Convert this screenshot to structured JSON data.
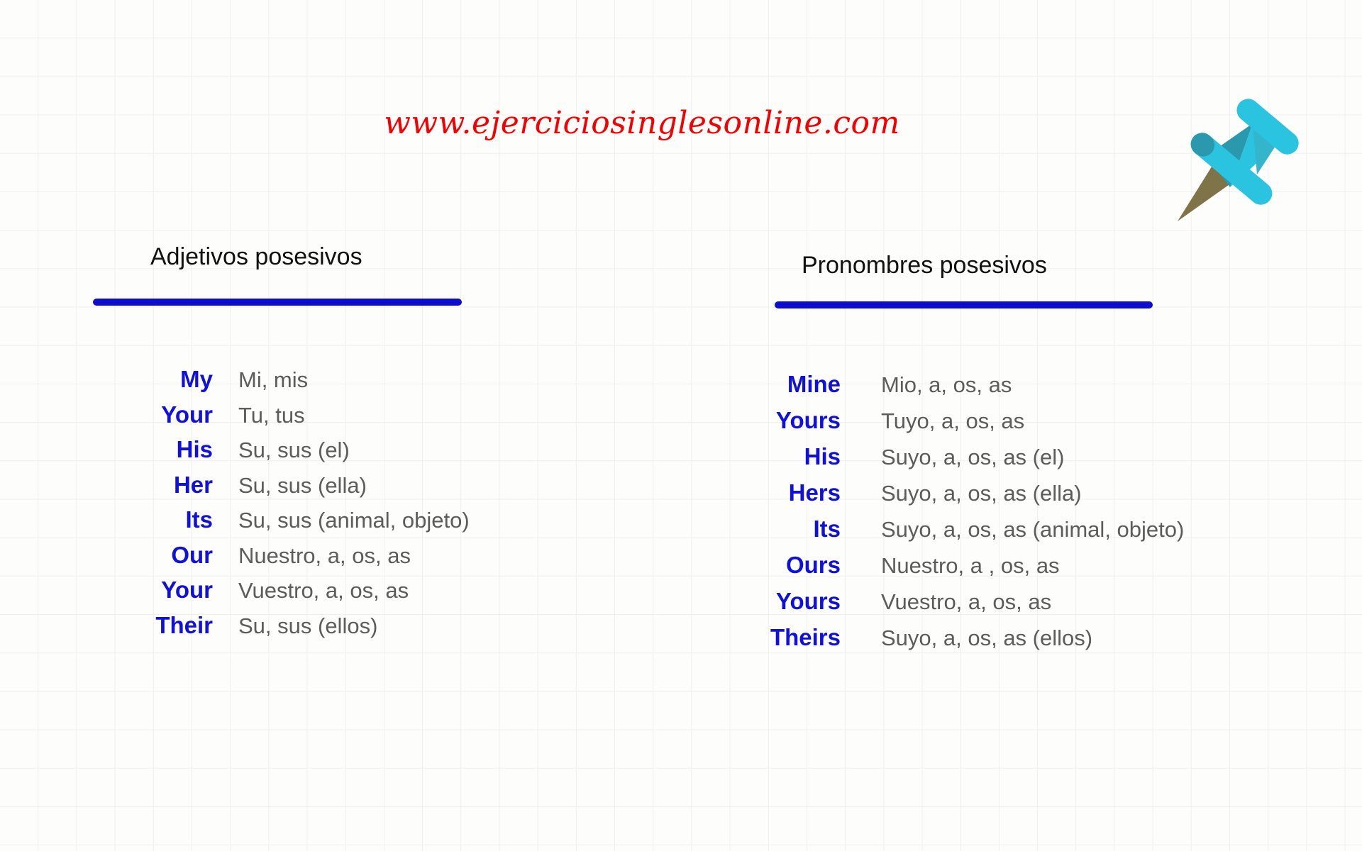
{
  "site_title": "www.ejerciciosinglesonline.com",
  "colors": {
    "title_red": "#f40000",
    "rule_blue": "#0d0dd2",
    "word_blue": "#1010dd",
    "translation_gray": "#5c5c5c",
    "heading_black": "#111111",
    "pin_head_light": "#2bc4e0",
    "pin_head_mid": "#33b5cc",
    "pin_head_dark": "#2a98ad",
    "pin_needle": "#7f7448",
    "grid_line": "#efefee",
    "page_background": "#fdfdfb"
  },
  "icons": {
    "pushpin": "pushpin-icon"
  },
  "columns": [
    {
      "id": "adjectives",
      "heading": "Adjetivos posesivos",
      "rows": [
        {
          "en": "My",
          "es": "Mi, mis"
        },
        {
          "en": "Your",
          "es": "Tu, tus"
        },
        {
          "en": "His",
          "es": "Su, sus (el)"
        },
        {
          "en": "Her",
          "es": "Su, sus (ella)"
        },
        {
          "en": "Its",
          "es": "Su, sus (animal, objeto)"
        },
        {
          "en": "Our",
          "es": "Nuestro, a, os, as"
        },
        {
          "en": "Your",
          "es": "Vuestro, a, os, as"
        },
        {
          "en": "Their",
          "es": "Su, sus (ellos)"
        }
      ]
    },
    {
      "id": "pronouns",
      "heading": "Pronombres posesivos",
      "rows": [
        {
          "en": "Mine",
          "es": "Mio, a, os, as"
        },
        {
          "en": "Yours",
          "es": "Tuyo, a, os, as"
        },
        {
          "en": "His",
          "es": "Suyo, a, os, as (el)"
        },
        {
          "en": "Hers",
          "es": "Suyo, a, os, as (ella)"
        },
        {
          "en": "Its",
          "es": "Suyo, a, os, as (animal, objeto)"
        },
        {
          "en": "Ours",
          "es": "Nuestro, a , os, as"
        },
        {
          "en": "Yours",
          "es": "Vuestro, a, os, as"
        },
        {
          "en": "Theirs",
          "es": "Suyo, a, os, as (ellos)"
        }
      ]
    }
  ]
}
